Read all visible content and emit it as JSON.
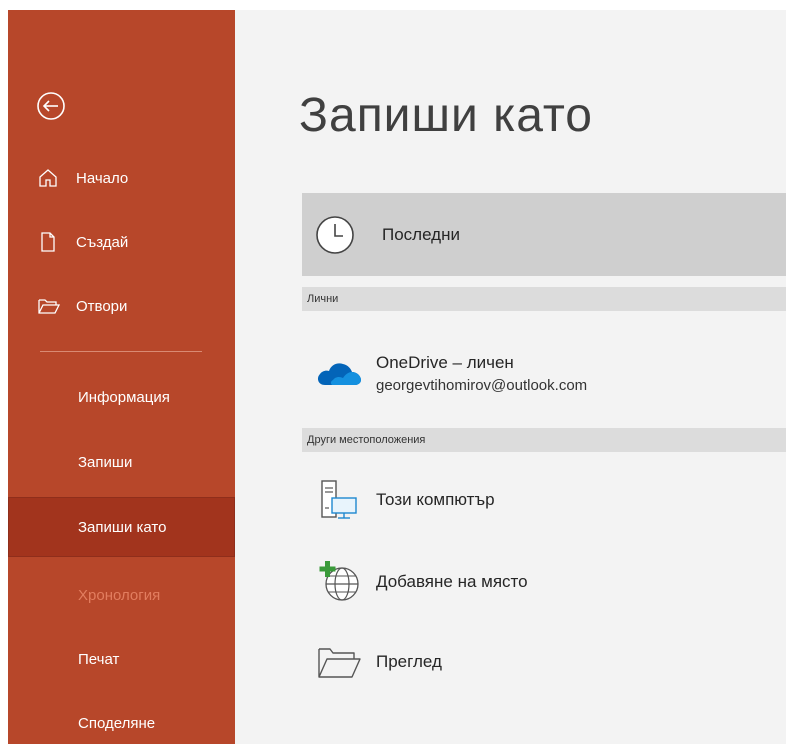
{
  "sidebar": {
    "back_label": "",
    "items": [
      {
        "label": "Начало",
        "icon": "home-icon"
      },
      {
        "label": "Създай",
        "icon": "new-document-icon"
      },
      {
        "label": "Отвори",
        "icon": "open-folder-icon"
      }
    ],
    "sub_items": [
      {
        "label": "Информация"
      },
      {
        "label": "Запиши"
      },
      {
        "label": "Запиши като",
        "state": "selected"
      },
      {
        "label": "Хронология",
        "state": "disabled"
      },
      {
        "label": "Печат"
      },
      {
        "label": "Споделяне"
      }
    ]
  },
  "main": {
    "title": "Запиши като",
    "recent": {
      "label": "Последни",
      "icon": "clock-icon"
    },
    "sections": [
      {
        "header": "Лични"
      },
      {
        "header": "Други местоположения"
      }
    ],
    "personal": {
      "onedrive_title": "OneDrive – личен",
      "onedrive_email": "georgevtihomirov@outlook.com",
      "icon": "onedrive-cloud-icon"
    },
    "other_locations": [
      {
        "label": "Този компютър",
        "icon": "computer-icon"
      },
      {
        "label": "Добавяне на място",
        "icon": "add-place-globe-icon"
      },
      {
        "label": "Преглед",
        "icon": "browse-folder-icon"
      }
    ]
  },
  "colors": {
    "sidebar_bg": "#b7472a",
    "sidebar_selected": "#a2341d",
    "disabled_text": "#e27d5f",
    "main_bg": "#f3f3f3",
    "onedrive_blue": "#0364b8"
  }
}
